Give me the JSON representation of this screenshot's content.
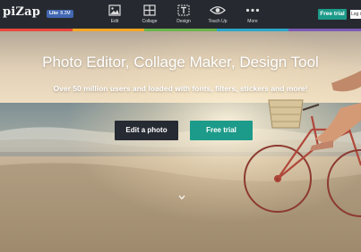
{
  "header": {
    "logo": "piZap",
    "fb_like_label": "Like",
    "fb_like_count": "8.2M",
    "nav": [
      {
        "label": "Edit",
        "icon": "image-icon"
      },
      {
        "label": "Collage",
        "icon": "collage-grid-icon"
      },
      {
        "label": "Design",
        "icon": "design-text-icon"
      },
      {
        "label": "Touch Up",
        "icon": "eye-icon"
      },
      {
        "label": "More",
        "icon": "more-dots-icon"
      }
    ],
    "free_trial_label": "Free trial",
    "login_label": "Log in"
  },
  "hero": {
    "headline": "Photo Editor, Collage Maker, Design Tool",
    "subheadline": "Over 50 million users and loaded with fonts, filters, stickers and more!",
    "edit_button_label": "Edit a photo",
    "trial_button_label": "Free trial"
  },
  "colors": {
    "accent": "#1d9b8a",
    "topbar": "#262a30",
    "facebook": "#4267b2",
    "stripe": [
      "#e8473c",
      "#f5a623",
      "#6bb44c",
      "#2aa7c9",
      "#7b5bb4"
    ]
  }
}
